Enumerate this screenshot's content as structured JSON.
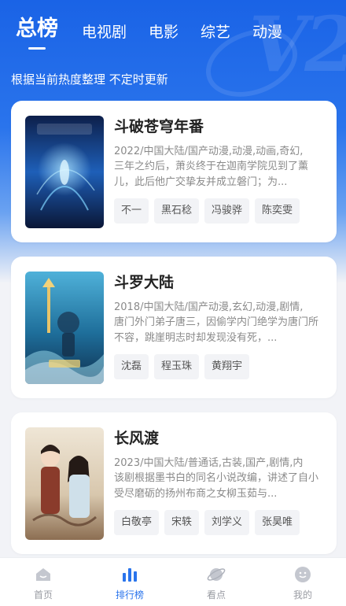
{
  "header": {
    "tabs": [
      {
        "label": "总榜",
        "active": true
      },
      {
        "label": "电视剧",
        "active": false
      },
      {
        "label": "电影",
        "active": false
      },
      {
        "label": "综艺",
        "active": false
      },
      {
        "label": "动漫",
        "active": false
      }
    ],
    "subtitle": "根据当前热度整理 不定时更新"
  },
  "rankings": [
    {
      "title": "斗破苍穹年番",
      "meta": "2022/中国大陆/国产动漫,动漫,动画,奇幻,",
      "desc": "三年之约后，萧炎终于在迦南学院见到了薰儿，此后他广交挚友并成立磐门；为...",
      "actors": [
        "不一",
        "黑石稔",
        "冯骏骅",
        "陈奕雯"
      ]
    },
    {
      "title": "斗罗大陆",
      "meta": "2018/中国大陆/国产动漫,玄幻,动漫,剧情,",
      "desc": "唐门外门弟子唐三，因偷学内门绝学为唐门所不容，跳崖明志时却发现没有死，...",
      "actors": [
        "沈磊",
        "程玉珠",
        "黄翔宇"
      ]
    },
    {
      "title": "长风渡",
      "meta": "2023/中国大陆/普通话,古装,国产,剧情,内",
      "desc": "该剧根据墨书白的同名小说改编，讲述了自小受尽磨砺的扬州布商之女柳玉茹与...",
      "actors": [
        "白敬亭",
        "宋轶",
        "刘学义",
        "张昊唯"
      ]
    }
  ],
  "bottom_nav": [
    {
      "label": "首页",
      "icon": "home-icon",
      "active": false
    },
    {
      "label": "排行榜",
      "icon": "bar-chart-icon",
      "active": true
    },
    {
      "label": "看点",
      "icon": "planet-icon",
      "active": false
    },
    {
      "label": "我的",
      "icon": "smiley-profile-icon",
      "active": false
    }
  ],
  "colors": {
    "accent": "#2a74ec",
    "header_blue": "#1a63e6",
    "inactive": "#9a9ca3"
  }
}
